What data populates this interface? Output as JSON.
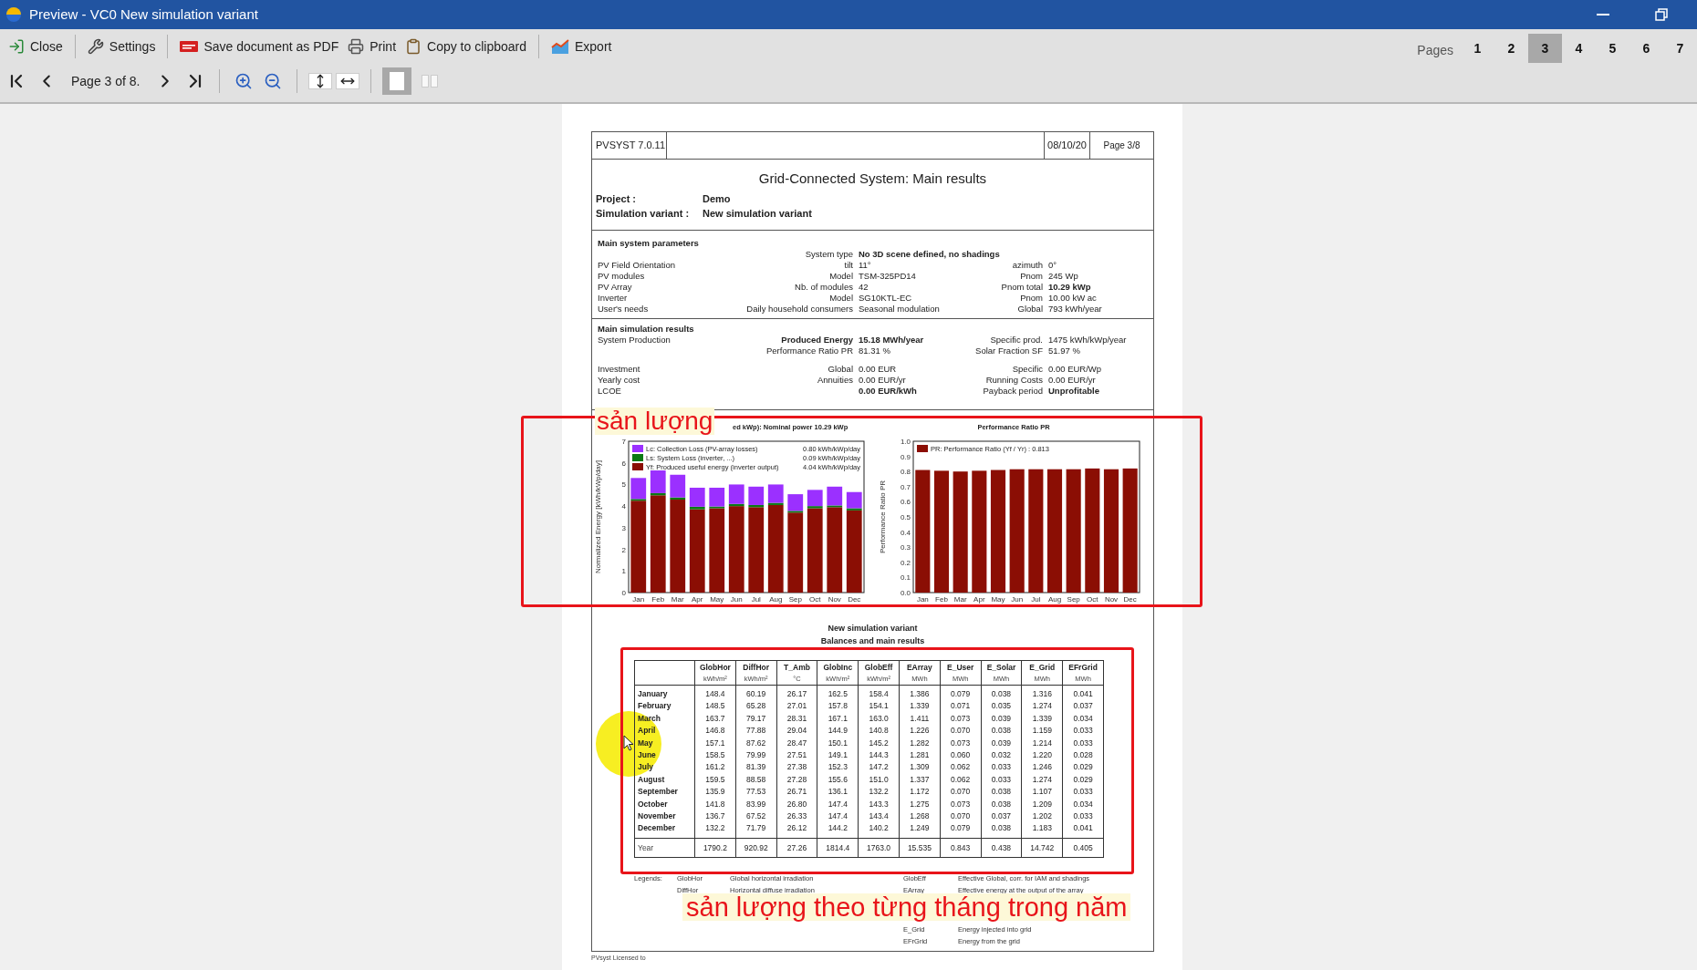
{
  "window": {
    "title": "Preview - VC0 New simulation variant"
  },
  "toolbar": [
    {
      "label": "Close",
      "kind": "close",
      "separator_after": true
    },
    {
      "label": "Settings",
      "kind": "settings",
      "separator_after": true
    },
    {
      "label": "Save document as PDF",
      "kind": "pdf",
      "separator_after": false
    },
    {
      "label": "Print",
      "kind": "print",
      "separator_after": false
    },
    {
      "label": "Copy to clipboard",
      "kind": "clipboard",
      "separator_after": true
    },
    {
      "label": "Export",
      "kind": "export",
      "separator_after": false
    }
  ],
  "pages": {
    "label": "Pages",
    "items": [
      {
        "label": "1",
        "selected": false
      },
      {
        "label": "2",
        "selected": false
      },
      {
        "label": "3",
        "selected": true
      },
      {
        "label": "4",
        "selected": false
      },
      {
        "label": "5",
        "selected": false
      },
      {
        "label": "6",
        "selected": false
      },
      {
        "label": "7",
        "selected": false
      }
    ]
  },
  "navigation": {
    "page_label": "Page 3 of 8."
  },
  "view_modes": [
    {
      "kind": "single",
      "selected": true
    },
    {
      "kind": "double",
      "selected": false
    }
  ],
  "report": {
    "software": "PVSYST 7.0.11",
    "date": "08/10/20",
    "page": "Page 3/8",
    "title": "Grid-Connected System: Main results",
    "project": {
      "label": "Project :",
      "value": "Demo"
    },
    "variant": {
      "label": "Simulation variant :",
      "value": "New simulation variant"
    },
    "parameters": {
      "heading": "Main system parameters",
      "rows": [
        {
          "key": "System type",
          "value": "No 3D scene defined, no shadings",
          "value_bold": true,
          "key_bold": false
        },
        {
          "label": "PV Field Orientation",
          "key": "tilt",
          "value": "11°",
          "value_bold": false,
          "key2": "azimuth",
          "value2": "0°",
          "value2_bold": false,
          "key_bold": false
        },
        {
          "label": "PV modules",
          "key": "Model",
          "value": "TSM-325PD14",
          "value_bold": false,
          "key2": "Pnom",
          "value2": "245 Wp",
          "value2_bold": false,
          "key_bold": false
        },
        {
          "label": "PV Array",
          "key": "Nb. of modules",
          "value": "42",
          "value_bold": false,
          "key2": "Pnom total",
          "value2": "10.29 kWp",
          "value2_bold": true,
          "key_bold": false
        },
        {
          "label": "Inverter",
          "key": "Model",
          "value": "SG10KTL-EC",
          "value_bold": false,
          "key2": "Pnom",
          "value2": "10.00 kW ac",
          "value2_bold": false,
          "key_bold": false
        },
        {
          "label": "User's needs",
          "key": "Daily household consumers",
          "value": "Seasonal modulation",
          "value_bold": false,
          "key2": "Global",
          "value2": "793 kWh/year",
          "value2_bold": false,
          "key_bold": false
        }
      ]
    },
    "results": {
      "heading": "Main simulation results",
      "rows": [
        {
          "label": "System Production",
          "key": "Produced Energy",
          "value": "15.18 MWh/year",
          "value_bold": true,
          "key2": "Specific prod.",
          "value2": "1475 kWh/kWp/year",
          "value2_bold": false,
          "key_bold": true
        },
        {
          "key": "Performance Ratio PR",
          "value": "81.31 %",
          "value_bold": false,
          "key2": "Solar Fraction SF",
          "value2": "51.97 %",
          "value2_bold": false,
          "key_bold": false
        },
        {
          "label": "Investment",
          "key": "Global",
          "value": "0.00 EUR",
          "value_bold": false,
          "key2": "Specific",
          "value2": "0.00 EUR/Wp",
          "value2_bold": false,
          "key_bold": false
        },
        {
          "label": "Yearly cost",
          "key": "Annuities",
          "value": "0.00 EUR/yr",
          "value_bold": false,
          "key2": "Running Costs",
          "value2": "0.00 EUR/yr",
          "value2_bold": false,
          "key_bold": false
        },
        {
          "label": "LCOE",
          "value": "0.00 EUR/kWh",
          "value_bold": true,
          "key2": "Payback period",
          "value2": "Unprofitable",
          "value2_bold": true
        }
      ]
    },
    "charts": [
      {
        "title": "ed kWp):  Nominal power 10.29 kWp",
        "chart_data": {
          "type": "bar",
          "stacked": true,
          "legend": "upper left",
          "ylabel": "Normalized Energy [kWh/kWp/day]",
          "categories": [
            "Jan",
            "Feb",
            "Mar",
            "Apr",
            "May",
            "Jun",
            "Jul",
            "Aug",
            "Sep",
            "Oct",
            "Nov",
            "Dec"
          ],
          "ylim": [
            0,
            7
          ],
          "yticks": [
            0,
            1,
            2,
            3,
            4,
            5,
            6,
            7
          ],
          "series": [
            {
              "name": "Lc: Collection Loss (PV-array losses)",
              "color": "#9b30ff",
              "values": [
                0.97,
                1.05,
                1.05,
                0.88,
                0.87,
                0.9,
                0.85,
                0.85,
                0.77,
                0.75,
                0.87,
                0.75
              ]
            },
            {
              "name": "Ls: System Loss (inverter, ...)",
              "color": "#0a7a14",
              "values": [
                0.08,
                0.1,
                0.1,
                0.12,
                0.08,
                0.1,
                0.1,
                0.1,
                0.08,
                0.1,
                0.08,
                0.1
              ]
            },
            {
              "name": "Yf: Produced useful energy (inverter output)",
              "color": "#8b0e04",
              "values": [
                4.25,
                4.5,
                4.3,
                3.85,
                3.9,
                4.0,
                3.95,
                4.05,
                3.7,
                3.9,
                3.95,
                3.8
              ]
            }
          ],
          "annotations": [
            {
              "text": "0.80 kWh/kWp/day"
            },
            {
              "text": "0.09 kWh/kWp/day"
            },
            {
              "text": "4.04 kWh/kWp/day"
            }
          ]
        }
      },
      {
        "title": "Performance Ratio PR",
        "chart_data": {
          "type": "bar",
          "legend": "upper left",
          "ylabel": "Performance Ratio PR",
          "categories": [
            "Jan",
            "Feb",
            "Mar",
            "Apr",
            "May",
            "Jun",
            "Jul",
            "Aug",
            "Sep",
            "Oct",
            "Nov",
            "Dec"
          ],
          "ylim": [
            0,
            1
          ],
          "yticks": [
            {
              "value": 0,
              "label": "0.0"
            },
            {
              "value": 0.1,
              "label": "0.1"
            },
            {
              "value": 0.2,
              "label": "0.2"
            },
            {
              "value": 0.3,
              "label": "0.3"
            },
            {
              "value": 0.4,
              "label": "0.4"
            },
            {
              "value": 0.5,
              "label": "0.5"
            },
            {
              "value": 0.6,
              "label": "0.6"
            },
            {
              "value": 0.7,
              "label": "0.7"
            },
            {
              "value": 0.8,
              "label": "0.8"
            },
            {
              "value": 0.9,
              "label": "0.9"
            },
            {
              "value": 1,
              "label": "1.0"
            }
          ],
          "series": [
            {
              "name": "PR: Performance Ratio (Yf / Yr) :  0.813",
              "color": "#8b0e04",
              "values": [
                0.81,
                0.805,
                0.8,
                0.805,
                0.81,
                0.815,
                0.815,
                0.815,
                0.815,
                0.82,
                0.815,
                0.82
              ]
            }
          ]
        }
      }
    ],
    "table": {
      "title": "New simulation variant",
      "subtitle": "Balances and main results",
      "columns": [
        {
          "name": "GlobHor",
          "unit": "kWh/m²"
        },
        {
          "name": "DiffHor",
          "unit": "kWh/m²"
        },
        {
          "name": "T_Amb",
          "unit": "°C"
        },
        {
          "name": "GlobInc",
          "unit": "kWh/m²"
        },
        {
          "name": "GlobEff",
          "unit": "kWh/m²"
        },
        {
          "name": "EArray",
          "unit": "MWh"
        },
        {
          "name": "E_User",
          "unit": "MWh"
        },
        {
          "name": "E_Solar",
          "unit": "MWh"
        },
        {
          "name": "E_Grid",
          "unit": "MWh"
        },
        {
          "name": "EFrGrid",
          "unit": "MWh"
        }
      ],
      "rows": [
        {
          "month": "January",
          "values": [
            "148.4",
            "60.19",
            "26.17",
            "162.5",
            "158.4",
            "1.386",
            "0.079",
            "0.038",
            "1.316",
            "0.041"
          ]
        },
        {
          "month": "February",
          "values": [
            "148.5",
            "65.28",
            "27.01",
            "157.8",
            "154.1",
            "1.339",
            "0.071",
            "0.035",
            "1.274",
            "0.037"
          ]
        },
        {
          "month": "March",
          "values": [
            "163.7",
            "79.17",
            "28.31",
            "167.1",
            "163.0",
            "1.411",
            "0.073",
            "0.039",
            "1.339",
            "0.034"
          ]
        },
        {
          "month": "April",
          "values": [
            "146.8",
            "77.88",
            "29.04",
            "144.9",
            "140.8",
            "1.226",
            "0.070",
            "0.038",
            "1.159",
            "0.033"
          ]
        },
        {
          "month": "May",
          "values": [
            "157.1",
            "87.62",
            "28.47",
            "150.1",
            "145.2",
            "1.282",
            "0.073",
            "0.039",
            "1.214",
            "0.033"
          ]
        },
        {
          "month": "June",
          "values": [
            "158.5",
            "79.99",
            "27.51",
            "149.1",
            "144.3",
            "1.281",
            "0.060",
            "0.032",
            "1.220",
            "0.028"
          ]
        },
        {
          "month": "July",
          "values": [
            "161.2",
            "81.39",
            "27.38",
            "152.3",
            "147.2",
            "1.309",
            "0.062",
            "0.033",
            "1.246",
            "0.029"
          ]
        },
        {
          "month": "August",
          "values": [
            "159.5",
            "88.58",
            "27.28",
            "155.6",
            "151.0",
            "1.337",
            "0.062",
            "0.033",
            "1.274",
            "0.029"
          ]
        },
        {
          "month": "September",
          "values": [
            "135.9",
            "77.53",
            "26.71",
            "136.1",
            "132.2",
            "1.172",
            "0.070",
            "0.038",
            "1.107",
            "0.033"
          ]
        },
        {
          "month": "October",
          "values": [
            "141.8",
            "83.99",
            "26.80",
            "147.4",
            "143.3",
            "1.275",
            "0.073",
            "0.038",
            "1.209",
            "0.034"
          ]
        },
        {
          "month": "November",
          "values": [
            "136.7",
            "67.52",
            "26.33",
            "147.4",
            "143.4",
            "1.268",
            "0.070",
            "0.037",
            "1.202",
            "0.033"
          ]
        },
        {
          "month": "December",
          "values": [
            "132.2",
            "71.79",
            "26.12",
            "144.2",
            "140.2",
            "1.249",
            "0.079",
            "0.038",
            "1.183",
            "0.041"
          ]
        }
      ],
      "total": {
        "label": "Year",
        "values": [
          "1790.2",
          "920.92",
          "27.26",
          "1814.4",
          "1763.0",
          "15.535",
          "0.843",
          "0.438",
          "14.742",
          "0.405"
        ]
      }
    },
    "legends": {
      "label": "Legends:",
      "left": [
        {
          "abbr": "GlobHor",
          "text": "Global horizontal irradiation"
        },
        {
          "abbr": "DiffHor",
          "text": "Horizontal diffuse irradiation"
        }
      ],
      "right": [
        {
          "abbr": "GlobEff",
          "text": "Effective Global, corr. for IAM and shadings"
        },
        {
          "abbr": "EArray",
          "text": "Effective energy at the output of the array"
        },
        {
          "abbr": "E_Grid",
          "text": "Energy injected into grid"
        },
        {
          "abbr": "EFrGrid",
          "text": "Energy from the grid"
        }
      ]
    },
    "footer": "PVsyst Licensed to"
  },
  "annotations": [
    {
      "text": "sản lượng"
    },
    {
      "text": "sản lượng theo từng tháng trong năm"
    }
  ]
}
